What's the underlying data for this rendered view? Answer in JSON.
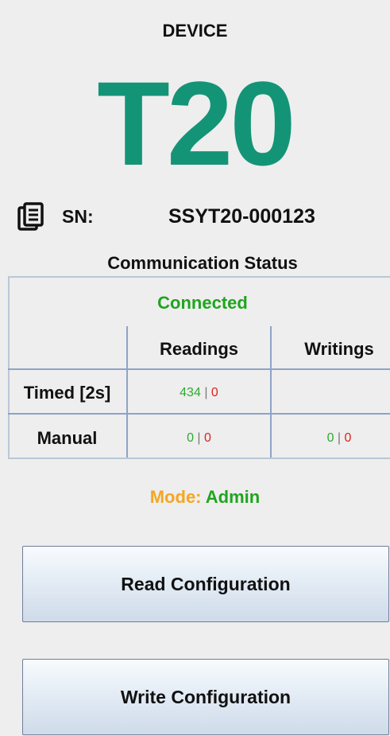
{
  "device": {
    "label": "DEVICE",
    "model": "T20",
    "model_color": "#149477",
    "sn_icon": "document-icon",
    "sn_label": "SN:",
    "sn_value": "SSYT20-000123"
  },
  "communication": {
    "title": "Communication Status",
    "status": "Connected",
    "status_color": "#1fa51f",
    "columns": [
      "Readings",
      "Writings"
    ],
    "rows": [
      {
        "label": "Timed [2s]",
        "readings": {
          "ok": "434",
          "err": "0"
        },
        "writings": null
      },
      {
        "label": "Manual",
        "readings": {
          "ok": "0",
          "err": "0"
        },
        "writings": {
          "ok": "0",
          "err": "0"
        }
      }
    ],
    "separator": "|"
  },
  "mode": {
    "label": "Mode:",
    "value": "Admin",
    "label_color": "#f5a623",
    "value_color": "#1fa51f"
  },
  "buttons": {
    "read_label": "Read Configuration",
    "write_label": "Write Configuration"
  }
}
